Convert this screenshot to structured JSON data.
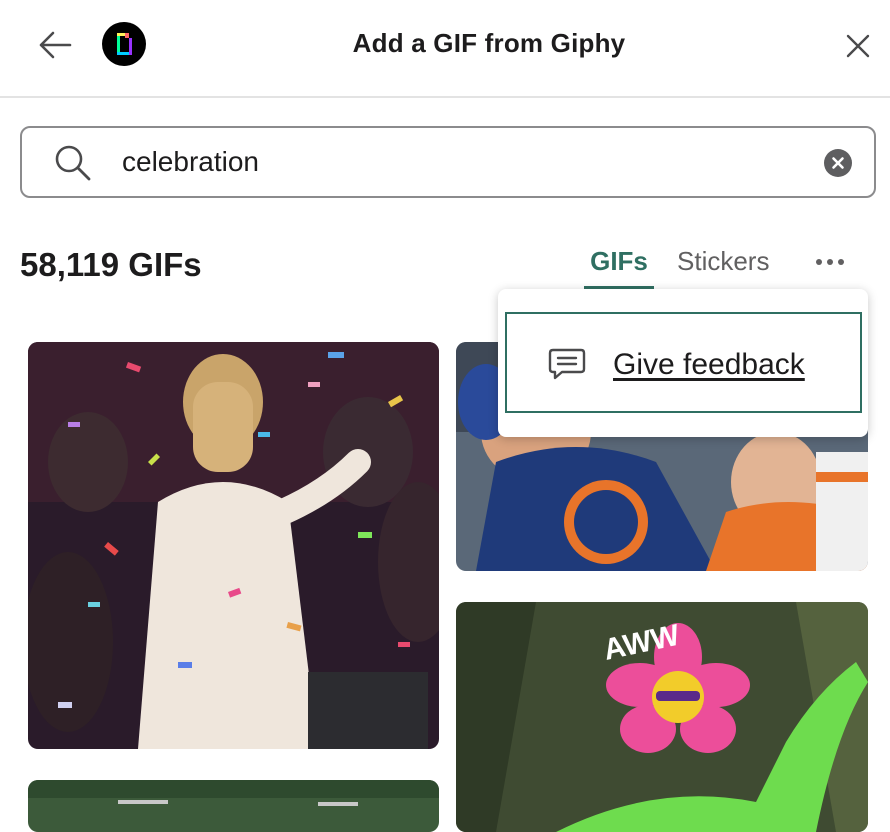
{
  "header": {
    "title": "Add a GIF from Giphy",
    "back_icon": "arrow-left-icon",
    "logo_icon": "giphy-logo",
    "close_icon": "close-icon"
  },
  "search": {
    "value": "celebration",
    "icon": "search-icon",
    "clear_icon": "clear-icon"
  },
  "results": {
    "count_label": "58,119 GIFs"
  },
  "tabs": [
    {
      "label": "GIFs",
      "active": true
    },
    {
      "label": "Stickers",
      "active": false
    }
  ],
  "more_icon": "more-horizontal-icon",
  "menu": {
    "items": [
      {
        "label": "Give feedback",
        "icon": "feedback-icon"
      }
    ]
  },
  "gifs": [
    {
      "text": ""
    },
    {
      "text": ""
    },
    {
      "text": "AWW"
    },
    {
      "text": ""
    }
  ],
  "colors": {
    "accent": "#2f6f62",
    "header_border": "#e3e3e3"
  }
}
